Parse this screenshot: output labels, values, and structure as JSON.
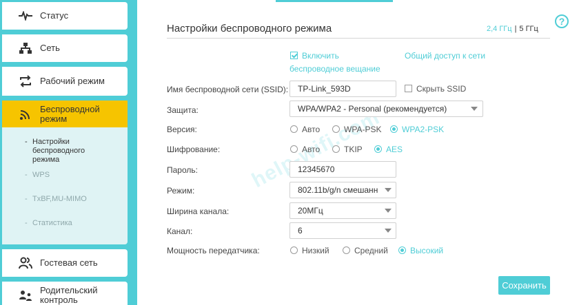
{
  "sidebar": {
    "items": [
      {
        "label": "Статус",
        "icon": "pulse-icon"
      },
      {
        "label": "Сеть",
        "icon": "network-icon"
      },
      {
        "label": "Рабочий режим",
        "icon": "mode-switch-icon"
      },
      {
        "label_line1": "Беспроводной",
        "label_line2": "режим",
        "icon": "wifi-icon",
        "active": true
      },
      {
        "label": "Гостевая сеть",
        "icon": "guest-users-icon"
      },
      {
        "label_line1": "Родительский",
        "label_line2": "контроль",
        "icon": "parental-control-icon"
      }
    ],
    "submenu": [
      {
        "line1": "Настройки",
        "line2": "беспроводного",
        "line3": "режима",
        "current": true
      },
      {
        "label": "WPS"
      },
      {
        "label": "TxBF,MU-MIMO"
      },
      {
        "label": "Статистика"
      }
    ]
  },
  "header": {
    "title": "Настройки беспроводного режима",
    "band_24": "2,4 ГГц",
    "band_sep": "|",
    "band_5": "5 ГГц",
    "help": "?"
  },
  "form": {
    "enable_line1": "Включить",
    "enable_line2": "беспроводное вещание",
    "share_link": "Общий доступ к сети",
    "ssid_label": "Имя беспроводной сети (SSID):",
    "ssid_value": "TP-Link_593D",
    "hide_ssid": "Скрыть SSID",
    "security_label": "Защита:",
    "security_value": "WPA/WPA2 - Personal (рекомендуется)",
    "version_label": "Версия:",
    "version_options": [
      "Авто",
      "WPA-PSK",
      "WPA2-PSK"
    ],
    "encryption_label": "Шифрование:",
    "encryption_options": [
      "Авто",
      "TKIP",
      "AES"
    ],
    "password_label": "Пароль:",
    "password_value": "12345670",
    "mode_label": "Режим:",
    "mode_value": "802.11b/g/n смешанн",
    "width_label": "Ширина канала:",
    "width_value": "20МГц",
    "channel_label": "Канал:",
    "channel_value": "6",
    "power_label": "Мощность передатчика:",
    "power_options": [
      "Низкий",
      "Средний",
      "Высокий"
    ],
    "save": "Сохранить"
  },
  "watermark": "help-wifi.com",
  "colors": {
    "accent": "#4fcdd6",
    "active": "#f6c400",
    "submenu_bg": "#dff3f4"
  }
}
